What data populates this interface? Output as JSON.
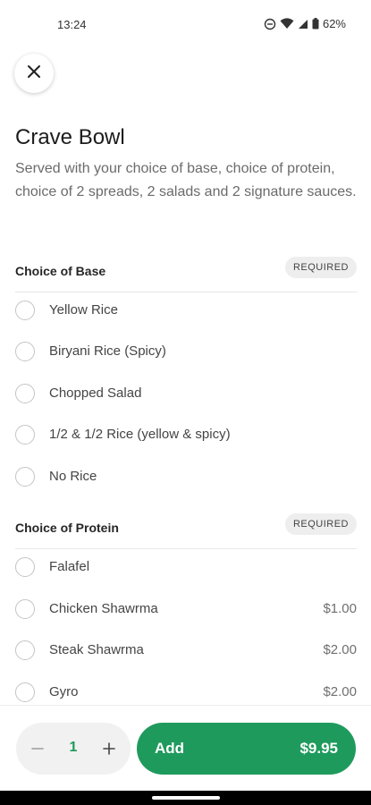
{
  "status_bar": {
    "time": "13:24",
    "battery": "62%"
  },
  "item": {
    "title": "Crave Bowl",
    "description": "Served with your choice of base, choice of protein, choice of 2 spreads, 2 salads and 2 signature sauces."
  },
  "sections": [
    {
      "label": "Choice of Base",
      "badge": "REQUIRED",
      "options": [
        {
          "label": "Yellow Rice",
          "price": ""
        },
        {
          "label": "Biryani Rice (Spicy)",
          "price": ""
        },
        {
          "label": "Chopped Salad",
          "price": ""
        },
        {
          "label": "1/2 & 1/2 Rice (yellow & spicy)",
          "price": ""
        },
        {
          "label": "No Rice",
          "price": ""
        }
      ]
    },
    {
      "label": "Choice of Protein",
      "badge": "REQUIRED",
      "options": [
        {
          "label": "Falafel",
          "price": ""
        },
        {
          "label": "Chicken Shawrma",
          "price": "$1.00"
        },
        {
          "label": "Steak Shawrma",
          "price": "$2.00"
        },
        {
          "label": "Gyro",
          "price": "$2.00"
        }
      ]
    }
  ],
  "footer": {
    "quantity": "1",
    "add_label": "Add",
    "add_price": "$9.95"
  },
  "colors": {
    "accent": "#1f9a5d"
  }
}
